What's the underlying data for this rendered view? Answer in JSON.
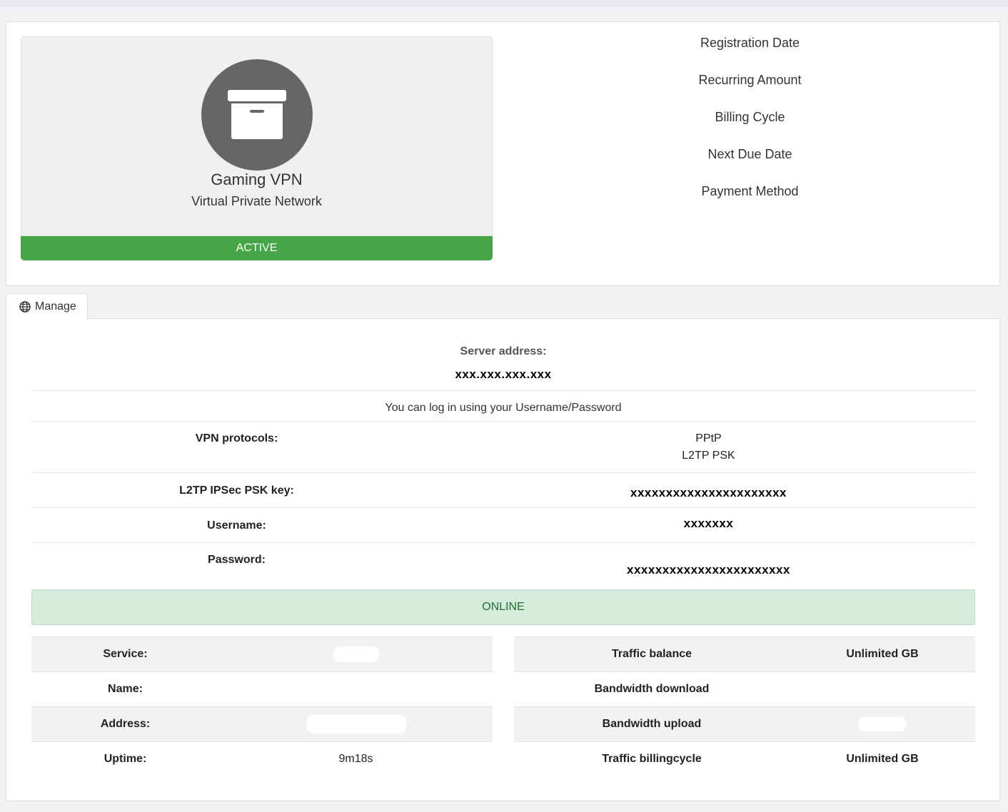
{
  "product": {
    "name": "Gaming VPN",
    "group": "Virtual Private Network",
    "status": "ACTIVE",
    "icon": "archive-box-icon"
  },
  "info_items": [
    "Registration Date",
    "Recurring Amount",
    "Billing Cycle",
    "Next Due Date",
    "Payment Method"
  ],
  "tab": {
    "label": "Manage",
    "icon": "globe-icon"
  },
  "vpn": {
    "server_label": "Server address:",
    "server_value": "xxx.xxx.xxx.xxx",
    "login_note": "You can log in using your Username/Password",
    "protocols_label": "VPN protocols:",
    "protocols": [
      "PPtP",
      "L2TP PSK"
    ],
    "psk_label": "L2TP IPSec PSK key:",
    "psk_value": "xxxxxxxxxxxxxxxxxxxxxx",
    "username_label": "Username:",
    "username_value": "xxxxxxx",
    "password_label": "Password:",
    "password_value": "xxxxxxxxxxxxxxxxxxxxxxx"
  },
  "online_status": "ONLINE",
  "left_stats": [
    {
      "key": "Service:",
      "value": ""
    },
    {
      "key": "Name:",
      "value": ""
    },
    {
      "key": "Address:",
      "value": ""
    },
    {
      "key": "Uptime:",
      "value": "9m18s"
    }
  ],
  "right_stats": [
    {
      "key": "Traffic balance",
      "value": "Unlimited GB"
    },
    {
      "key": "Bandwidth download",
      "value": ""
    },
    {
      "key": "Bandwidth upload",
      "value": ""
    },
    {
      "key": "Traffic billingcycle",
      "value": "Unlimited GB"
    }
  ],
  "colors": {
    "active": "#46a546",
    "online_bg": "#d4ecdb",
    "online_text": "#2a6a35",
    "icon_circle": "#666666"
  }
}
